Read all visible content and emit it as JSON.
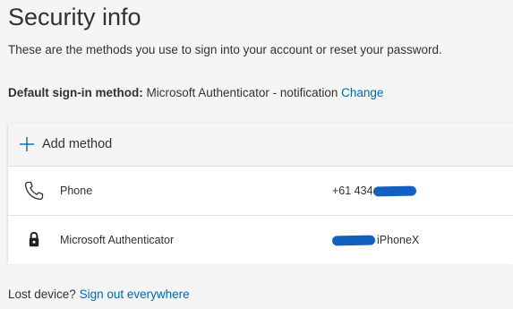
{
  "header": {
    "title": "Security info",
    "description": "These are the methods you use to sign into your account or reset your password."
  },
  "default_method": {
    "label": "Default sign-in method:",
    "value": "Microsoft Authenticator - notification",
    "change_link": "Change"
  },
  "methods_panel": {
    "add_method_label": "Add method",
    "add_method_icon": "plus-icon",
    "methods": [
      {
        "name": "Phone",
        "icon": "phone-icon",
        "detail_prefix": "+61 434",
        "detail_suffix": ""
      },
      {
        "name": "Microsoft Authenticator",
        "icon": "lock-icon",
        "detail_prefix": "",
        "detail_suffix": "iPhoneX"
      }
    ]
  },
  "footer": {
    "lost_device_text": "Lost device?",
    "sign_out_link": "Sign out everywhere"
  },
  "colors": {
    "link": "#0067b8",
    "redaction": "#1460c0",
    "background": "#f5f5f5",
    "panel": "#ffffff",
    "text": "#323130"
  }
}
